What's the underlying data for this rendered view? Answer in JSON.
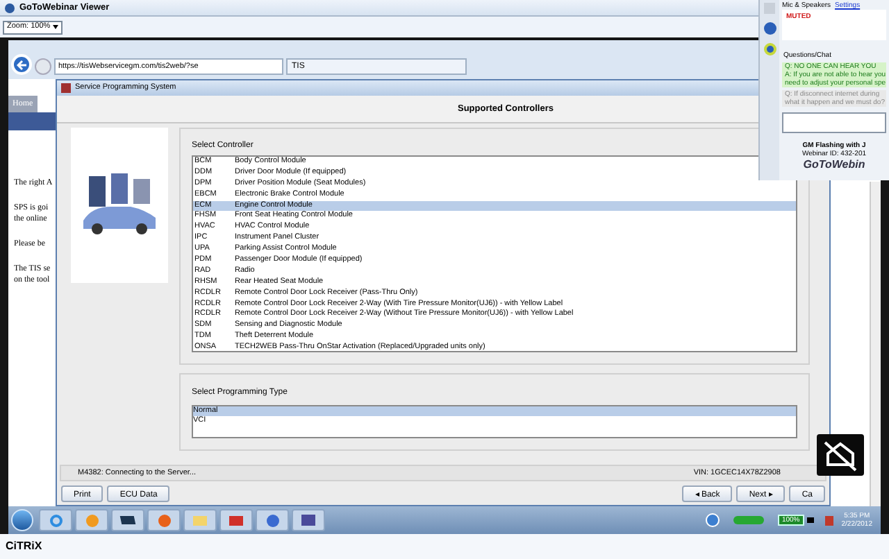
{
  "window": {
    "title": "GoToWebinar Viewer"
  },
  "zoom": {
    "value": "Zoom: 100%"
  },
  "browser": {
    "url": "https://tisWebservicegm.com/tis2web/?se",
    "tab": "TIS"
  },
  "page": {
    "tab": "Home",
    "lines": [
      "The right A",
      "SPS is goi",
      "the online",
      "Please be",
      "The TIS se",
      "on the tool"
    ]
  },
  "sps": {
    "title": "Service Programming System",
    "header": "Supported Controllers",
    "controller_label": "Select Controller",
    "controllers": [
      {
        "code": "BCM",
        "name": "Body Control Module",
        "selected": false
      },
      {
        "code": "DDM",
        "name": "Driver Door Module (If equipped)",
        "selected": false
      },
      {
        "code": "DPM",
        "name": "Driver Position Module (Seat Modules)",
        "selected": false
      },
      {
        "code": "EBCM",
        "name": "Electronic Brake Control Module",
        "selected": false
      },
      {
        "code": "ECM",
        "name": "Engine Control Module",
        "selected": true
      },
      {
        "code": "FHSM",
        "name": "Front Seat Heating Control Module",
        "selected": false
      },
      {
        "code": "HVAC",
        "name": "HVAC Control Module",
        "selected": false
      },
      {
        "code": "IPC",
        "name": "Instrument Panel Cluster",
        "selected": false
      },
      {
        "code": "UPA",
        "name": "Parking Assist Control Module",
        "selected": false
      },
      {
        "code": "PDM",
        "name": "Passenger Door Module (If equipped)",
        "selected": false
      },
      {
        "code": "RAD",
        "name": "Radio",
        "selected": false
      },
      {
        "code": "RHSM",
        "name": "Rear Heated Seat Module",
        "selected": false
      },
      {
        "code": "RCDLR",
        "name": "Remote Control Door Lock Receiver (Pass-Thru Only)",
        "selected": false
      },
      {
        "code": "RCDLR",
        "name": "Remote Control Door Lock Receiver 2-Way (With Tire Pressure Monitor(UJ6)) - with Yellow Label",
        "selected": false
      },
      {
        "code": "RCDLR",
        "name": "Remote Control Door Lock Receiver 2-Way (Without Tire Pressure Monitor(UJ6)) - with Yellow Label",
        "selected": false
      },
      {
        "code": "SDM",
        "name": "Sensing and Diagnostic Module",
        "selected": false
      },
      {
        "code": "TDM",
        "name": "Theft Deterrent Module",
        "selected": false
      },
      {
        "code": "ONSA",
        "name": "TECH2WEB Pass-Thru OnStar Activation (Replaced/Upgraded units only)",
        "selected": false
      }
    ],
    "type_label": "Select Programming Type",
    "types": [
      {
        "label": "Normal",
        "selected": true
      },
      {
        "label": "VCI",
        "selected": false
      }
    ],
    "status": "M4382: Connecting to the Server...",
    "vin": "VIN: 1GCEC14X78Z2908",
    "buttons_left": [
      "Print",
      "ECU Data"
    ],
    "buttons_right": [
      "◂ Back",
      "Next ▸",
      "Ca"
    ]
  },
  "panel": {
    "audio": "Mic & Speakers",
    "settings": "Settings",
    "muted": "MUTED",
    "chat_title": "Questions/Chat",
    "messages": [
      {
        "kind": "answered",
        "lines": [
          "Q: NO ONE CAN HEAR YOU",
          "A: If you are not able to hear you",
          "need to adjust your personal spe"
        ]
      },
      {
        "kind": "pending",
        "lines": [
          "Q: If disconnect internet during",
          "what it happen and we must do?"
        ]
      }
    ],
    "webinar": "GM Flashing with J",
    "webinar_id": "Webinar ID: 432-201",
    "logo": "GoToWebin"
  },
  "taskbar": {
    "time": "5:35 PM",
    "date": "2/22/2012",
    "battery": "100%"
  },
  "citrix": "CiTRiX"
}
